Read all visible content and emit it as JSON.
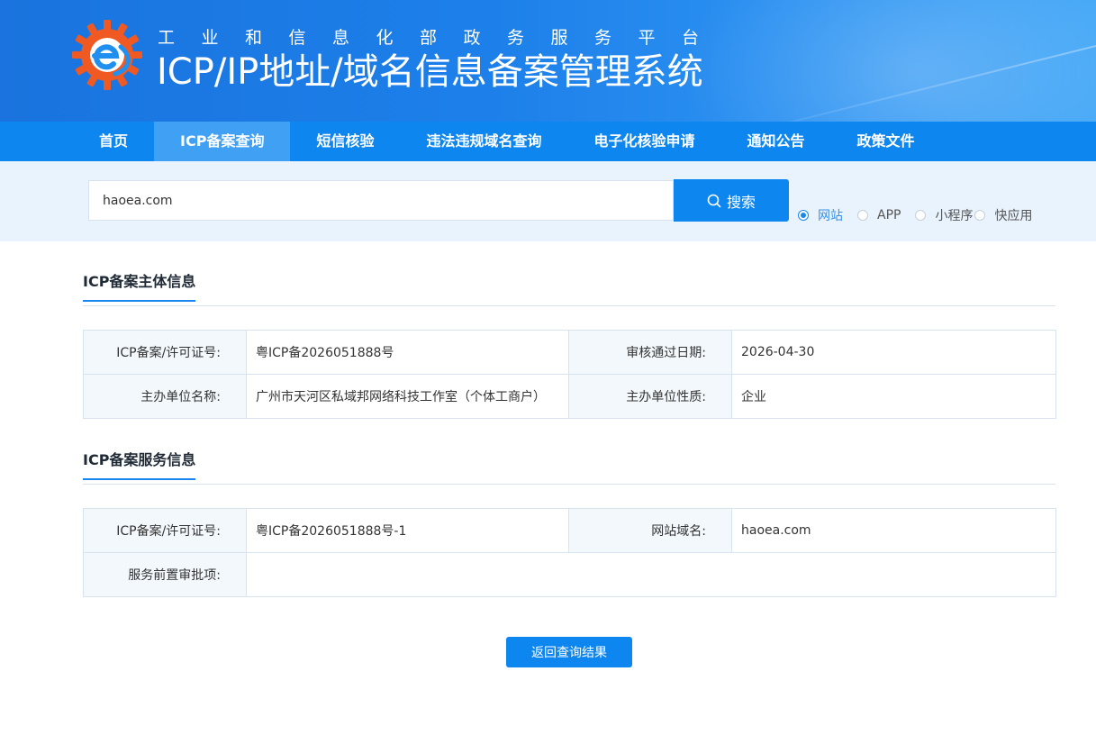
{
  "header": {
    "subtitle": "工业和信息化部政务服务平台",
    "title": "ICP/IP地址/域名信息备案管理系统"
  },
  "nav": {
    "items": [
      {
        "label": "首页"
      },
      {
        "label": "ICP备案查询",
        "active": true
      },
      {
        "label": "短信核验"
      },
      {
        "label": "违法违规域名查询"
      },
      {
        "label": "电子化核验申请"
      },
      {
        "label": "通知公告"
      },
      {
        "label": "政策文件"
      }
    ]
  },
  "search": {
    "value": "haoea.com",
    "button_label": "搜索",
    "types": [
      {
        "label": "网站",
        "checked": true
      },
      {
        "label": "APP",
        "checked": false
      },
      {
        "label": "小程序",
        "checked": false
      },
      {
        "label": "快应用",
        "checked": false
      }
    ]
  },
  "subject_info": {
    "title": "ICP备案主体信息",
    "rows": [
      {
        "label1": "ICP备案/许可证号:",
        "value1": "粤ICP备2026051888号",
        "label2": "审核通过日期:",
        "value2": "2026-04-30"
      },
      {
        "label1": "主办单位名称:",
        "value1": "广州市天河区私域邦网络科技工作室（个体工商户）",
        "label2": "主办单位性质:",
        "value2": "企业"
      }
    ]
  },
  "service_info": {
    "title": "ICP备案服务信息",
    "row1": {
      "label1": "ICP备案/许可证号:",
      "value1": "粤ICP备2026051888号-1",
      "label2": "网站域名:",
      "value2": "haoea.com"
    },
    "row2": {
      "label": "服务前置审批项:",
      "value": ""
    }
  },
  "back_button_label": "返回查询结果",
  "colors": {
    "primary": "#0d86f0",
    "nav_active": "#3fa0f4",
    "search_band": "#e8f3fd",
    "label_cell": "#f3f8fd",
    "logo_orange": "#f05a22",
    "logo_blue": "#1f8ff0"
  }
}
